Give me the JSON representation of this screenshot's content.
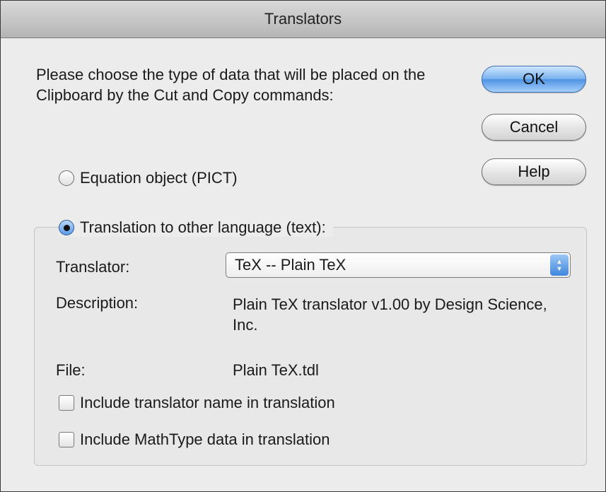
{
  "window": {
    "title": "Translators"
  },
  "prompt": "Please choose the type of data that will be placed on the Clipboard by the Cut and Copy commands:",
  "buttons": {
    "ok": "OK",
    "cancel": "Cancel",
    "help": "Help"
  },
  "options": {
    "equation_object": {
      "label": "Equation object (PICT)",
      "selected": false
    },
    "translation": {
      "label": "Translation to other language (text):",
      "selected": true
    }
  },
  "translator": {
    "label": "Translator:",
    "selected": "TeX -- Plain TeX",
    "description_label": "Description:",
    "description": "Plain TeX translator v1.00 by Design Science, Inc.",
    "file_label": "File:",
    "file": "Plain TeX.tdl"
  },
  "checkboxes": {
    "include_name": {
      "label": "Include translator name in translation",
      "checked": false
    },
    "include_mathtype": {
      "label": "Include MathType data in translation",
      "checked": false
    }
  },
  "colors": {
    "default_button": "#5b9be8",
    "window_bg": "#ececec"
  }
}
